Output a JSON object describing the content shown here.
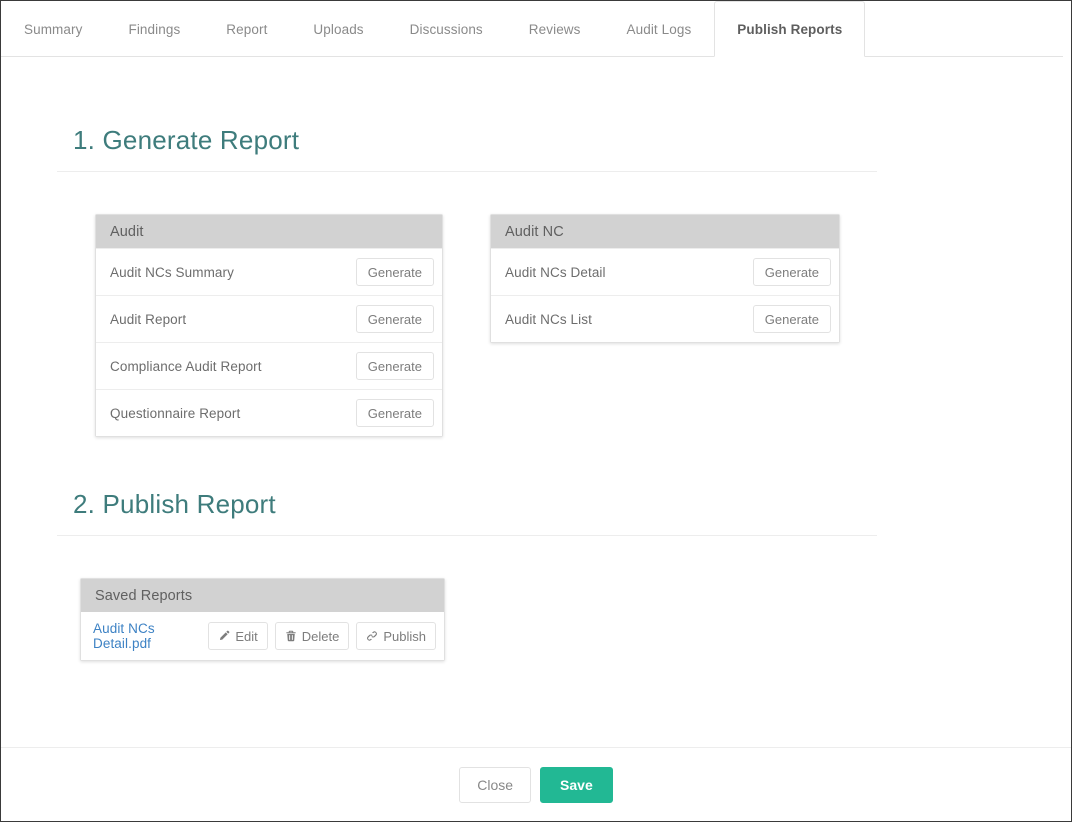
{
  "tabs": [
    {
      "label": "Summary",
      "active": false
    },
    {
      "label": "Findings",
      "active": false
    },
    {
      "label": "Report",
      "active": false
    },
    {
      "label": "Uploads",
      "active": false
    },
    {
      "label": "Discussions",
      "active": false
    },
    {
      "label": "Reviews",
      "active": false
    },
    {
      "label": "Audit Logs",
      "active": false
    },
    {
      "label": "Publish Reports",
      "active": true
    }
  ],
  "sections": {
    "generate": {
      "title": "1. Generate Report",
      "panels": [
        {
          "title": "Audit",
          "rows": [
            {
              "label": "Audit NCs Summary",
              "button": "Generate"
            },
            {
              "label": "Audit Report",
              "button": "Generate"
            },
            {
              "label": "Compliance Audit Report",
              "button": "Generate"
            },
            {
              "label": "Questionnaire Report",
              "button": "Generate"
            }
          ]
        },
        {
          "title": "Audit NC",
          "rows": [
            {
              "label": "Audit NCs Detail",
              "button": "Generate"
            },
            {
              "label": "Audit NCs List",
              "button": "Generate"
            }
          ]
        }
      ]
    },
    "publish": {
      "title": "2. Publish Report",
      "panel": {
        "title": "Saved Reports",
        "files": [
          {
            "name": "Audit NCs Detail.pdf",
            "actions": [
              {
                "label": "Edit",
                "icon": "pencil-icon"
              },
              {
                "label": "Delete",
                "icon": "trash-icon"
              },
              {
                "label": "Publish",
                "icon": "link-icon"
              }
            ]
          }
        ]
      }
    }
  },
  "footer": {
    "close_label": "Close",
    "save_label": "Save"
  },
  "colors": {
    "heading": "#3e7c7c",
    "save_button": "#22b894",
    "link": "#3d82c4",
    "panel_header": "#d2d2d2"
  }
}
